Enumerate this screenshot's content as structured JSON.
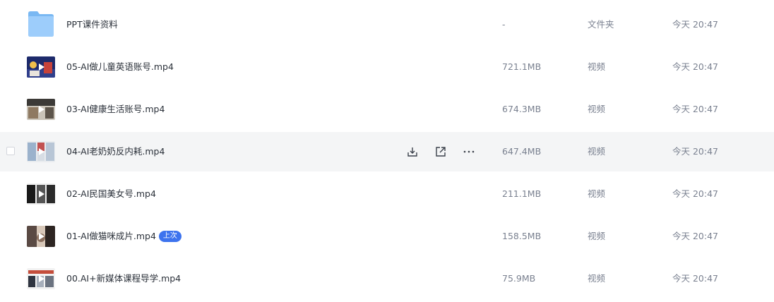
{
  "files": [
    {
      "name": "PPT课件资料",
      "size": "-",
      "type": "文件夹",
      "modified": "今天 20:47",
      "kind": "folder",
      "thumb_colors": [
        "#7fbdf6",
        "#a6d2fb"
      ]
    },
    {
      "name": "05-AI做儿童英语账号.mp4",
      "size": "721.1MB",
      "type": "视频",
      "modified": "今天 20:47",
      "kind": "video",
      "thumb_colors": [
        "#1d2a6b",
        "#c6423a",
        "#f1c04b"
      ]
    },
    {
      "name": "03-AI健康生活账号.mp4",
      "size": "674.3MB",
      "type": "视频",
      "modified": "今天 20:47",
      "kind": "video",
      "thumb_colors": [
        "#3c3a37",
        "#c9c3b8",
        "#8f7a62"
      ]
    },
    {
      "name": "04-AI老奶奶反内耗.mp4",
      "size": "647.4MB",
      "type": "视频",
      "modified": "今天 20:47",
      "kind": "video",
      "thumb_colors": [
        "#9bb2cc",
        "#e9ecef",
        "#c25252"
      ]
    },
    {
      "name": "02-AI民国美女号.mp4",
      "size": "211.1MB",
      "type": "视频",
      "modified": "今天 20:47",
      "kind": "video",
      "thumb_colors": [
        "#1a1a1a",
        "#efefef",
        "#555555"
      ]
    },
    {
      "name": "01-AI做猫咪成片.mp4",
      "size": "158.5MB",
      "type": "视频",
      "modified": "今天 20:47",
      "kind": "video",
      "badge": "上次",
      "thumb_colors": [
        "#5a4a44",
        "#d7c7b8",
        "#2d2522"
      ]
    },
    {
      "name": "00.AI+新媒体课程导学.mp4",
      "size": "75.9MB",
      "type": "视频",
      "modified": "今天 20:47",
      "kind": "video",
      "thumb_colors": [
        "#f2f2f2",
        "#c44d3b",
        "#2f3440"
      ]
    }
  ],
  "hover_row_index": 3,
  "row_icons": [
    "download-icon",
    "share-icon",
    "more-icon"
  ]
}
